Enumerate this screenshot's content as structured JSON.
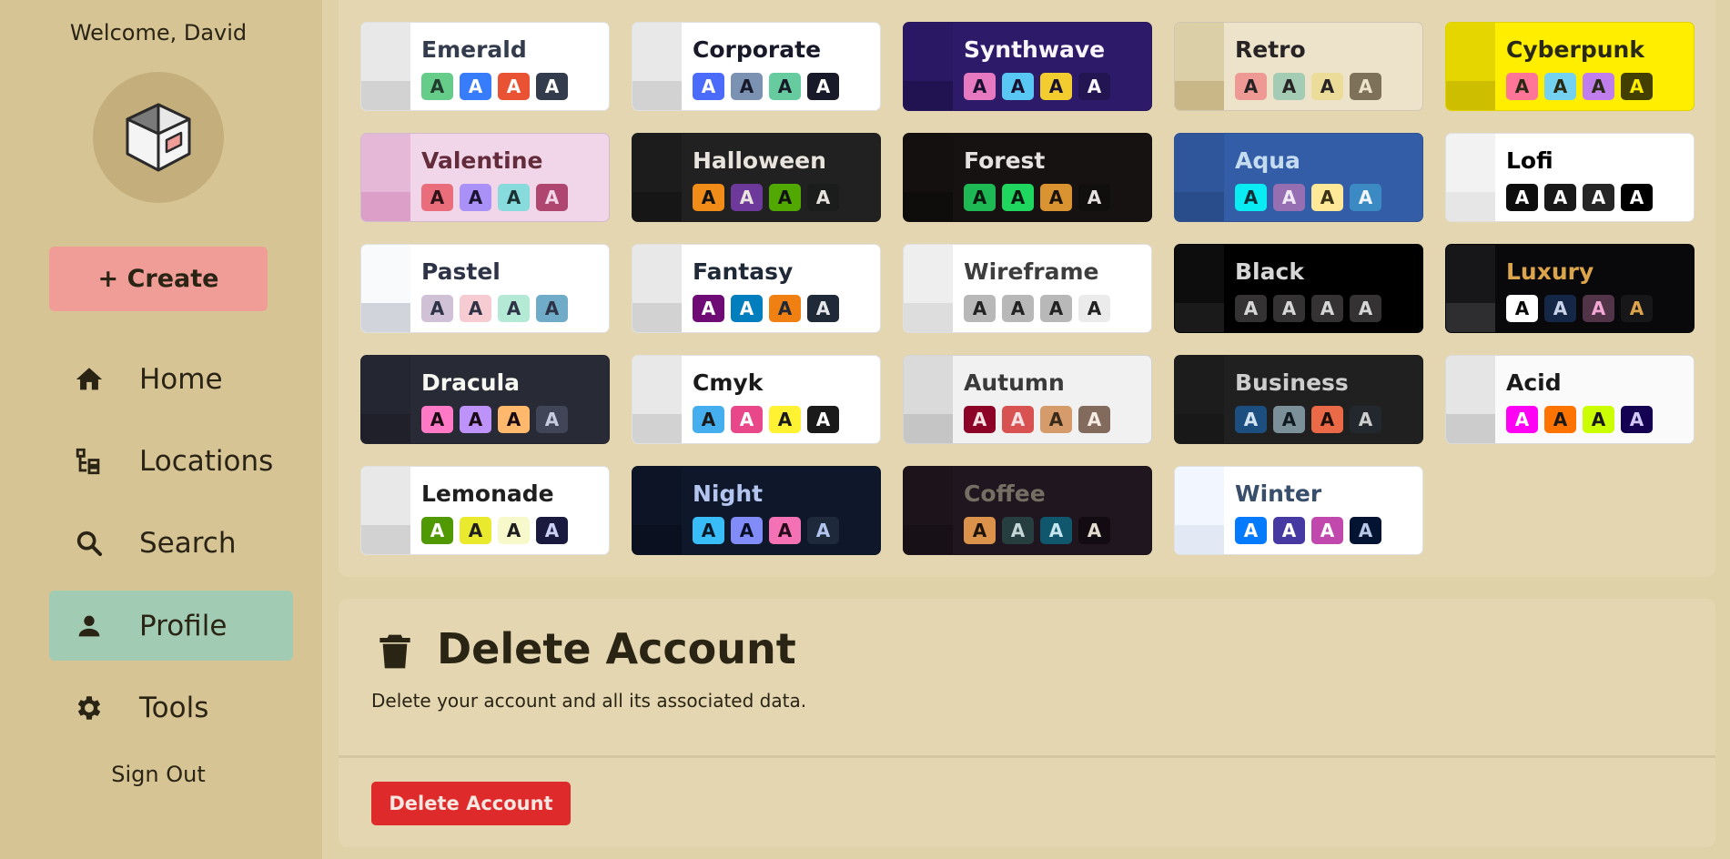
{
  "sidebar": {
    "welcome": "Welcome, David",
    "avatar_icon": "package-box-icon",
    "create_label": "+ Create",
    "nav": [
      {
        "label": "Home",
        "icon": "home-icon",
        "active": false
      },
      {
        "label": "Locations",
        "icon": "hierarchy-icon",
        "active": false
      },
      {
        "label": "Search",
        "icon": "search-icon",
        "active": false
      },
      {
        "label": "Profile",
        "icon": "person-icon",
        "active": true
      },
      {
        "label": "Tools",
        "icon": "gear-icon",
        "active": false
      }
    ],
    "sign_out": "Sign Out"
  },
  "themes": [
    {
      "name": "Emerald",
      "bg": "#ffffff",
      "fg": "#333c4d",
      "strip": [
        "#e8e8e8",
        "#d2d2d2"
      ],
      "swatches": [
        [
          "#66cc8a",
          "#223d30"
        ],
        [
          "#377cfb",
          "#ffffff"
        ],
        [
          "#ea5234",
          "#ffffff"
        ],
        [
          "#333c4d",
          "#ffffff"
        ]
      ]
    },
    {
      "name": "Corporate",
      "bg": "#ffffff",
      "fg": "#181a2a",
      "strip": [
        "#e8e8e8",
        "#d2d2d2"
      ],
      "swatches": [
        [
          "#4b6bfb",
          "#ffffff"
        ],
        [
          "#7b92b2",
          "#181a2a"
        ],
        [
          "#67cba0",
          "#181a2a"
        ],
        [
          "#181a2a",
          "#ffffff"
        ]
      ]
    },
    {
      "name": "Synthwave",
      "bg": "#2d1b69",
      "fg": "#f9f7fd",
      "strip": [
        "#2a1865",
        "#211352"
      ],
      "swatches": [
        [
          "#e779c1",
          "#1a1030"
        ],
        [
          "#58c7f3",
          "#1a1030"
        ],
        [
          "#f3cc30",
          "#1a1030"
        ],
        [
          "#221551",
          "#f9f7fd"
        ]
      ]
    },
    {
      "name": "Retro",
      "bg": "#ece3ca",
      "fg": "#282425",
      "strip": [
        "#dbcfa8",
        "#c9b787"
      ],
      "swatches": [
        [
          "#ef9995",
          "#282425"
        ],
        [
          "#a4cbb4",
          "#282425"
        ],
        [
          "#ebdc99",
          "#282425"
        ],
        [
          "#7d7259",
          "#ece3ca"
        ]
      ]
    },
    {
      "name": "Cyberpunk",
      "bg": "#ffee00",
      "fg": "#2a2a14",
      "strip": [
        "#e6d600",
        "#cdbe00"
      ],
      "swatches": [
        [
          "#ff7598",
          "#2a2a14"
        ],
        [
          "#75d1f0",
          "#2a2a14"
        ],
        [
          "#c07eec",
          "#2a2a14"
        ],
        [
          "#423f00",
          "#ffee00"
        ]
      ]
    },
    {
      "name": "Valentine",
      "bg": "#f0d6e8",
      "fg": "#632c3b",
      "strip": [
        "#e4b8d6",
        "#db9fc8"
      ],
      "swatches": [
        [
          "#e96d7b",
          "#2e1218"
        ],
        [
          "#a991f7",
          "#1b1533"
        ],
        [
          "#88dbdd",
          "#1b3233"
        ],
        [
          "#af4670",
          "#f0d6e8"
        ]
      ]
    },
    {
      "name": "Halloween",
      "bg": "#212121",
      "fg": "#e8e3dc",
      "strip": [
        "#1c1c1c",
        "#161616"
      ],
      "swatches": [
        [
          "#f28c18",
          "#131313"
        ],
        [
          "#6d3a9c",
          "#e8e3dc"
        ],
        [
          "#51a800",
          "#131313"
        ],
        [
          "#1b1d1d",
          "#e8e3dc"
        ]
      ]
    },
    {
      "name": "Forest",
      "bg": "#171212",
      "fg": "#e6e1e1",
      "strip": [
        "#141010",
        "#0f0c0c"
      ],
      "swatches": [
        [
          "#1eb854",
          "#0b1a10"
        ],
        [
          "#1fd65f",
          "#0b1a10"
        ],
        [
          "#d99330",
          "#1a120b"
        ],
        [
          "#110e0e",
          "#e6e1e1"
        ]
      ]
    },
    {
      "name": "Aqua",
      "bg": "#345da7",
      "fg": "#c5dcf0",
      "strip": [
        "#2f559a",
        "#294c8a"
      ],
      "swatches": [
        [
          "#09ecf3",
          "#0c2f38"
        ],
        [
          "#966fb3",
          "#f0e8f5"
        ],
        [
          "#ffe999",
          "#3a3315"
        ],
        [
          "#3b8ac4",
          "#f0f6fb"
        ]
      ]
    },
    {
      "name": "Lofi",
      "bg": "#ffffff",
      "fg": "#000000",
      "strip": [
        "#f2f2f2",
        "#e6e6e6"
      ],
      "swatches": [
        [
          "#0d0d0d",
          "#ffffff"
        ],
        [
          "#1a1919",
          "#ffffff"
        ],
        [
          "#262626",
          "#ffffff"
        ],
        [
          "#000000",
          "#ffffff"
        ]
      ]
    },
    {
      "name": "Pastel",
      "bg": "#ffffff",
      "fg": "#2f3347",
      "strip": [
        "#f9fafb",
        "#d1d5db"
      ],
      "swatches": [
        [
          "#d1c1d7",
          "#2f3347"
        ],
        [
          "#f6cbd1",
          "#2f3347"
        ],
        [
          "#b4e9d6",
          "#2f3347"
        ],
        [
          "#70acc7",
          "#2f3347"
        ]
      ]
    },
    {
      "name": "Fantasy",
      "bg": "#ffffff",
      "fg": "#1f2937",
      "strip": [
        "#e8e8e8",
        "#d2d2d2"
      ],
      "swatches": [
        [
          "#6e0b75",
          "#ffffff"
        ],
        [
          "#007ebd",
          "#ffffff"
        ],
        [
          "#f18013",
          "#1f2937"
        ],
        [
          "#1f2937",
          "#e5e7eb"
        ]
      ]
    },
    {
      "name": "Wireframe",
      "bg": "#ffffff",
      "fg": "#3d3d3d",
      "strip": [
        "#eeeeee",
        "#dddddd"
      ],
      "swatches": [
        [
          "#b8b8b8",
          "#222222"
        ],
        [
          "#b8b8b8",
          "#222222"
        ],
        [
          "#b8b8b8",
          "#222222"
        ],
        [
          "#ebebeb",
          "#222222"
        ]
      ]
    },
    {
      "name": "Black",
      "bg": "#000000",
      "fg": "#d6d6d6",
      "strip": [
        "#0d0d0d",
        "#1a1a1a"
      ],
      "swatches": [
        [
          "#343232",
          "#d6d6d6"
        ],
        [
          "#343232",
          "#d6d6d6"
        ],
        [
          "#343232",
          "#d6d6d6"
        ],
        [
          "#343232",
          "#d6d6d6"
        ]
      ]
    },
    {
      "name": "Luxury",
      "bg": "#09090b",
      "fg": "#dca54c",
      "strip": [
        "#171618",
        "#2e2d2f"
      ],
      "swatches": [
        [
          "#ffffff",
          "#09090b"
        ],
        [
          "#152747",
          "#c8d3e8"
        ],
        [
          "#513448",
          "#f3a8d6"
        ],
        [
          "#171618",
          "#dca54c"
        ]
      ]
    },
    {
      "name": "Dracula",
      "bg": "#282a36",
      "fg": "#f8f8f2",
      "strip": [
        "#242631",
        "#1f202a"
      ],
      "swatches": [
        [
          "#ff79c6",
          "#1a0a14"
        ],
        [
          "#bd93f9",
          "#1a0a14"
        ],
        [
          "#ffb86c",
          "#1a0a14"
        ],
        [
          "#414558",
          "#c7cbe0"
        ]
      ]
    },
    {
      "name": "Cmyk",
      "bg": "#ffffff",
      "fg": "#1a1a1a",
      "strip": [
        "#e8e8e8",
        "#d2d2d2"
      ],
      "swatches": [
        [
          "#45aeee",
          "#1a1a1a"
        ],
        [
          "#e8488a",
          "#ffffff"
        ],
        [
          "#fff232",
          "#1a1a1a"
        ],
        [
          "#1a1a1a",
          "#ffffff"
        ]
      ]
    },
    {
      "name": "Autumn",
      "bg": "#f1f1f1",
      "fg": "#3a3a3a",
      "strip": [
        "#dadada",
        "#c5c5c5"
      ],
      "swatches": [
        [
          "#8c0327",
          "#f5e0e3"
        ],
        [
          "#d85251",
          "#f5e0e3"
        ],
        [
          "#d59b6a",
          "#3a2a1a"
        ],
        [
          "#826a5c",
          "#f5ebe3"
        ]
      ]
    },
    {
      "name": "Business",
      "bg": "#202020",
      "fg": "#cdcdcd",
      "strip": [
        "#1c1c1c",
        "#181818"
      ],
      "swatches": [
        [
          "#1c4e80",
          "#d4e3f2"
        ],
        [
          "#7c909a",
          "#111a1e"
        ],
        [
          "#ea6947",
          "#1e0f0b"
        ],
        [
          "#23282e",
          "#cdcdcd"
        ]
      ]
    },
    {
      "name": "Acid",
      "bg": "#fafafa",
      "fg": "#1a1a1a",
      "strip": [
        "#e5e5e5",
        "#cccccc"
      ],
      "swatches": [
        [
          "#ff00f4",
          "#ffffff"
        ],
        [
          "#ff7400",
          "#1a1a1a"
        ],
        [
          "#cbfd03",
          "#1a1a1a"
        ],
        [
          "#140152",
          "#d1c8f5"
        ]
      ]
    },
    {
      "name": "Lemonade",
      "bg": "#ffffff",
      "fg": "#1f1f1f",
      "strip": [
        "#e8e8e8",
        "#d2d2d2"
      ],
      "swatches": [
        [
          "#519903",
          "#ffffff"
        ],
        [
          "#e9e92e",
          "#1f1f1f"
        ],
        [
          "#f7f9ca",
          "#1f1f1f"
        ],
        [
          "#191a3e",
          "#cbd0f5"
        ]
      ]
    },
    {
      "name": "Night",
      "bg": "#0f172a",
      "fg": "#b3c5ef",
      "strip": [
        "#0c1425",
        "#0a1020"
      ],
      "swatches": [
        [
          "#38bdf8",
          "#0a1a28"
        ],
        [
          "#818cf8",
          "#0a0f28"
        ],
        [
          "#f471b5",
          "#28091a"
        ],
        [
          "#1e293b",
          "#b3c5ef"
        ]
      ]
    },
    {
      "name": "Coffee",
      "bg": "#20161f",
      "fg": "#756e63",
      "strip": [
        "#1c131b",
        "#171016"
      ],
      "swatches": [
        [
          "#db924b",
          "#1f140a"
        ],
        [
          "#263e3f",
          "#c5d6d6"
        ],
        [
          "#10576d",
          "#c5e6ee"
        ],
        [
          "#120c12",
          "#e5dcd0"
        ]
      ]
    },
    {
      "name": "Winter",
      "bg": "#ffffff",
      "fg": "#394e6a",
      "strip": [
        "#f2f7ff",
        "#e3e9f4"
      ],
      "swatches": [
        [
          "#047aff",
          "#ffffff"
        ],
        [
          "#463aa2",
          "#ffffff"
        ],
        [
          "#c148ac",
          "#ffffff"
        ],
        [
          "#021431",
          "#b8c7e8"
        ]
      ]
    }
  ],
  "swatch_letter": "A",
  "delete_section": {
    "icon": "trash-icon",
    "title": "Delete Account",
    "description": "Delete your account and all its associated data.",
    "button_label": "Delete Account"
  }
}
